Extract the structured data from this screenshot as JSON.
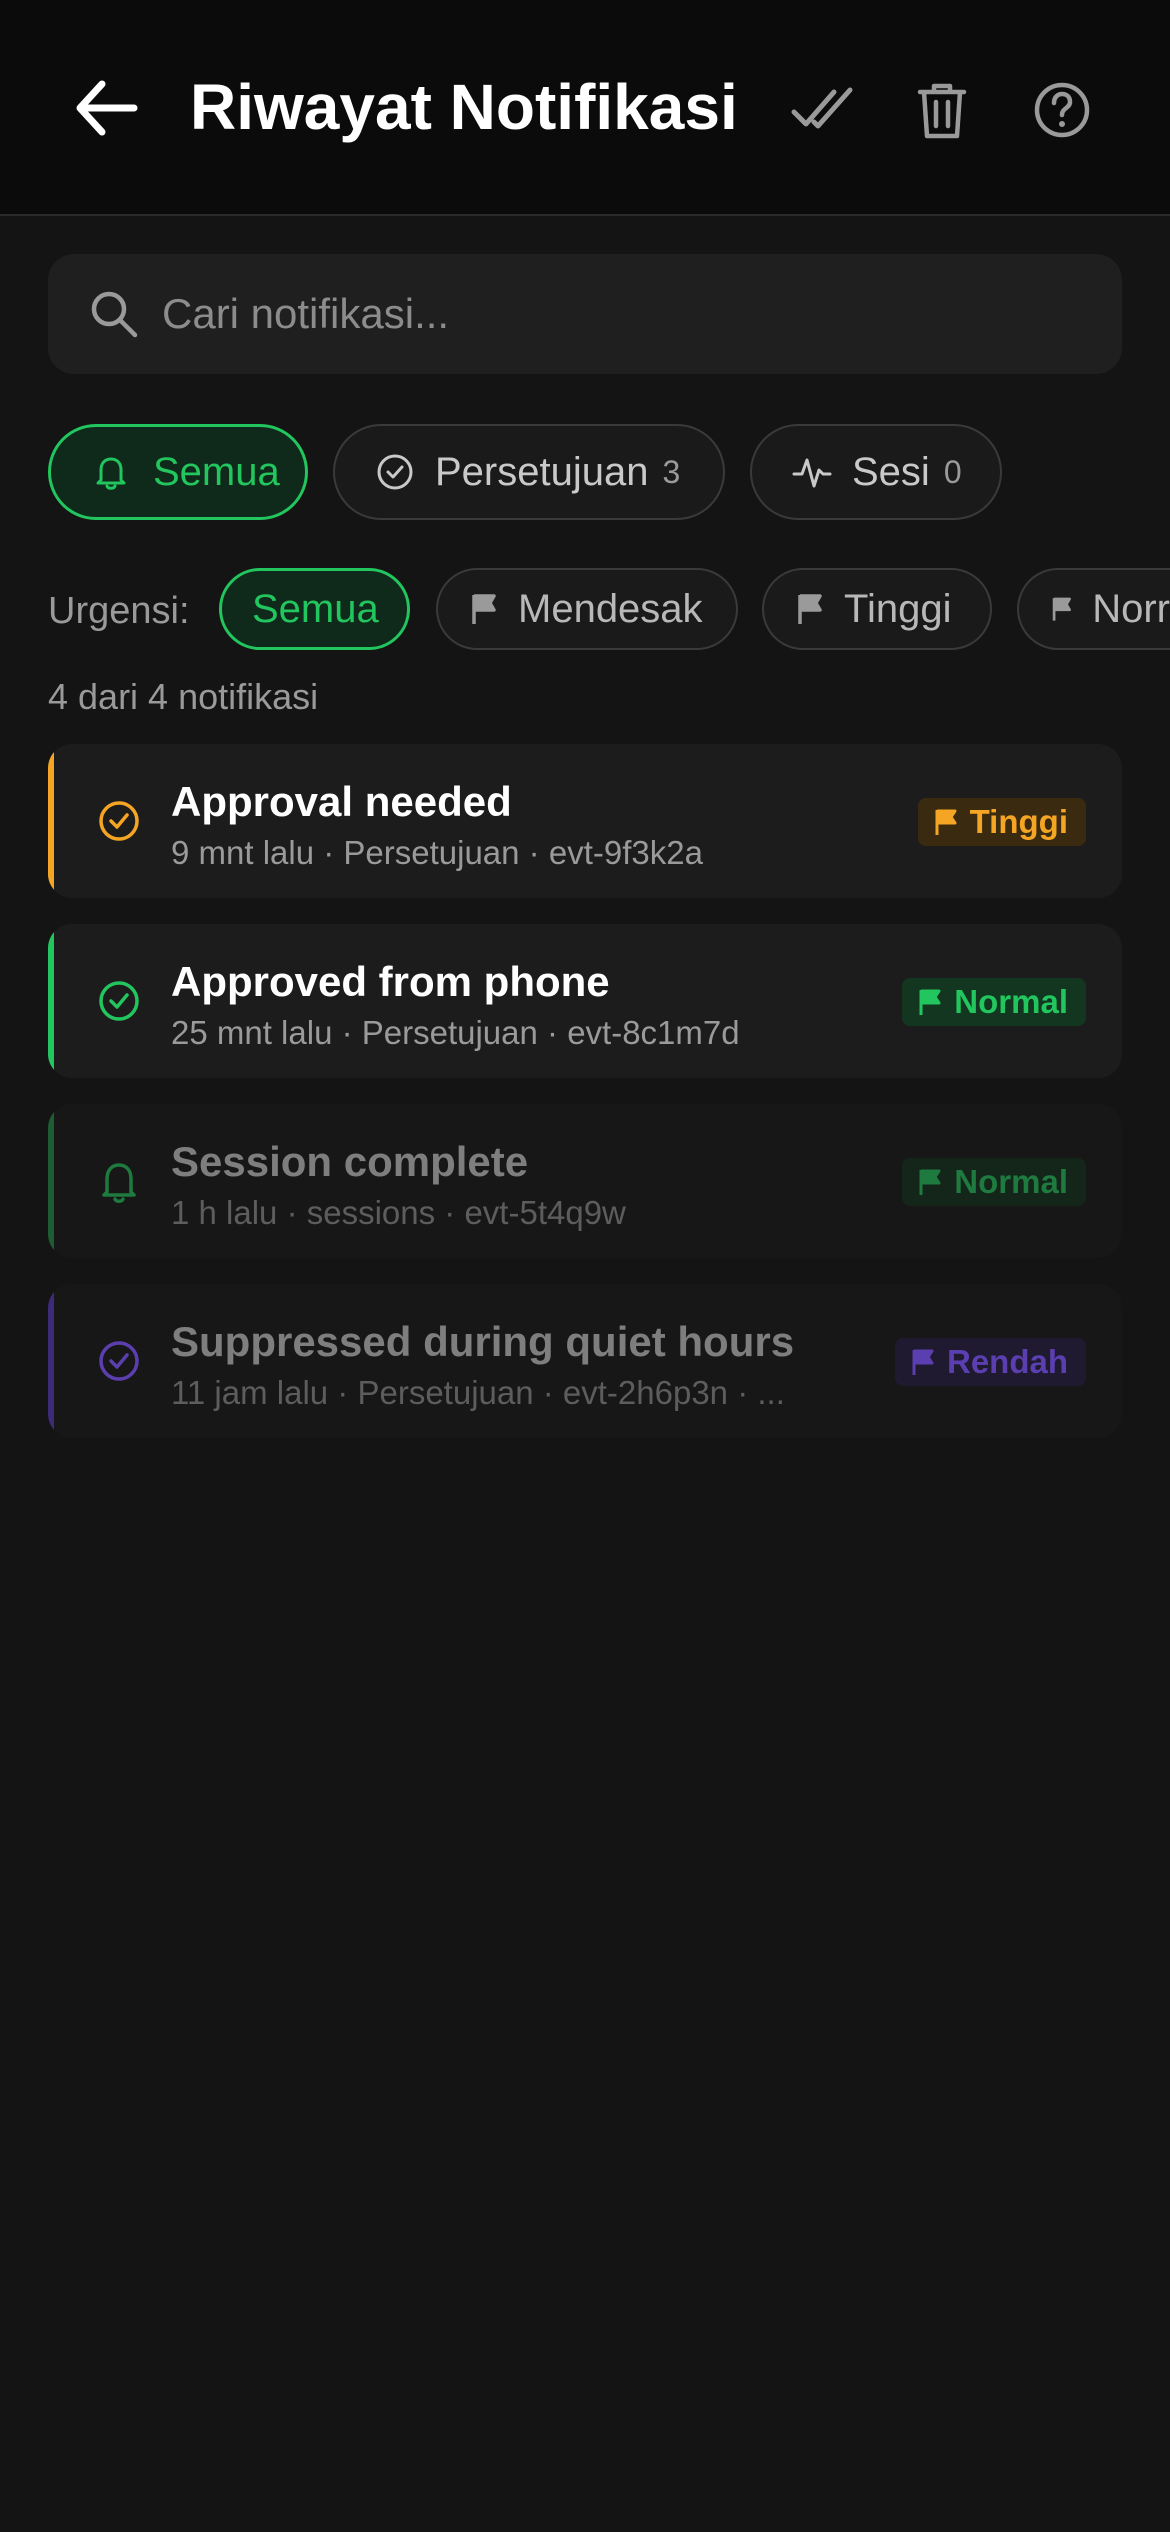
{
  "header": {
    "title": "Riwayat Notifikasi",
    "back_icon": "arrow-left-icon",
    "actions": [
      "double-check-icon",
      "trash-icon",
      "help-circle-icon"
    ]
  },
  "search": {
    "placeholder": "Cari notifikasi..."
  },
  "tabs": [
    {
      "label": "Semua",
      "icon": "bell-icon",
      "active": true
    },
    {
      "label": "Persetujuan",
      "count": "3",
      "icon": "check-circle-icon",
      "active": false
    },
    {
      "label": "Sesi",
      "count": "0",
      "icon": "activity-icon",
      "active": false
    }
  ],
  "urgency": {
    "label": "Urgensi:",
    "options": [
      {
        "label": "Semua",
        "active": true
      },
      {
        "label": "Mendesak",
        "icon": "flag-icon"
      },
      {
        "label": "Tinggi",
        "icon": "flag-icon"
      },
      {
        "label": "Norr",
        "icon": "flag-icon"
      }
    ]
  },
  "summary": "4 dari 4 notifikasi",
  "notifications": [
    {
      "title": "Approval needed",
      "meta": "9 mnt lalu · Persetujuan · evt-9f3k2a",
      "badge": "Tinggi",
      "color": "#f5a524",
      "icon": "check-circle-icon"
    },
    {
      "title": "Approved from phone",
      "meta": "25 mnt lalu · Persetujuan · evt-8c1m7d",
      "badge": "Normal",
      "color": "#22c55e",
      "icon": "check-circle-icon"
    },
    {
      "title": "Session complete",
      "meta": "1 h lalu · sessions · evt-5t4q9w",
      "badge": "Normal",
      "color": "#1e7a3f",
      "icon": "bell-icon"
    },
    {
      "title": "Suppressed during quiet hours",
      "meta": "11 jam lalu · Persetujuan · evt-2h6p3n · ...",
      "badge": "Rendah",
      "color": "#5b3fb0",
      "icon": "check-circle-icon"
    }
  ],
  "colors": {
    "accent": "#22c55e",
    "high": "#f5a524",
    "normal": "#22c55e",
    "low": "#6d4bd6"
  }
}
